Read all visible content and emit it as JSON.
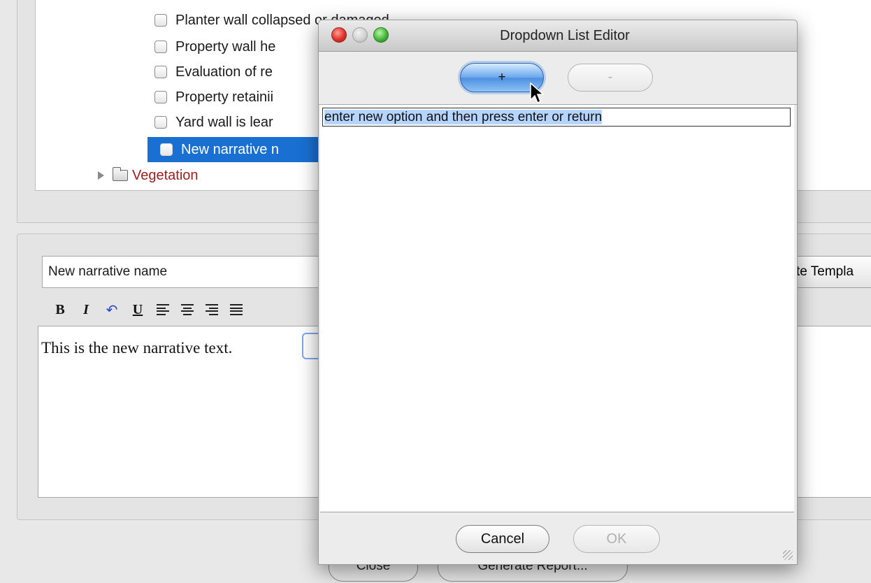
{
  "tree": {
    "items": [
      {
        "label": "Planter wall collapsed or damaged",
        "checked": false,
        "selected": false
      },
      {
        "label": "Property wall he",
        "checked": false,
        "selected": false
      },
      {
        "label": "Evaluation of re",
        "checked": false,
        "selected": false
      },
      {
        "label": "Property retainii",
        "checked": false,
        "selected": false
      },
      {
        "label": "Yard wall is lear",
        "checked": false,
        "selected": false
      },
      {
        "label": "New narrative n",
        "checked": false,
        "selected": true
      }
    ],
    "folder": {
      "label": "Vegetation",
      "icon": "folder-icon",
      "expanded": false,
      "color": "#9b1d1d"
    }
  },
  "narrative": {
    "name_value": "New narrative name",
    "save_template_label": "te Templa",
    "body_text": "This is the new narrative text.",
    "toolbar": {
      "bold": "B",
      "italic": "I",
      "undo": "↶",
      "underline": "U"
    }
  },
  "background_buttons": {
    "close_label": "Close",
    "generate_label": "Generate Report..."
  },
  "dialog": {
    "title": "Dropdown List Editor",
    "add_label": "+",
    "remove_label": "-",
    "new_option_text": "enter new option and then press enter or return",
    "cancel_label": "Cancel",
    "ok_label": "OK"
  },
  "colors": {
    "selection": "#1a6fd3",
    "text_highlight": "#b5d5ff",
    "folder_label": "#9b1d1d"
  }
}
